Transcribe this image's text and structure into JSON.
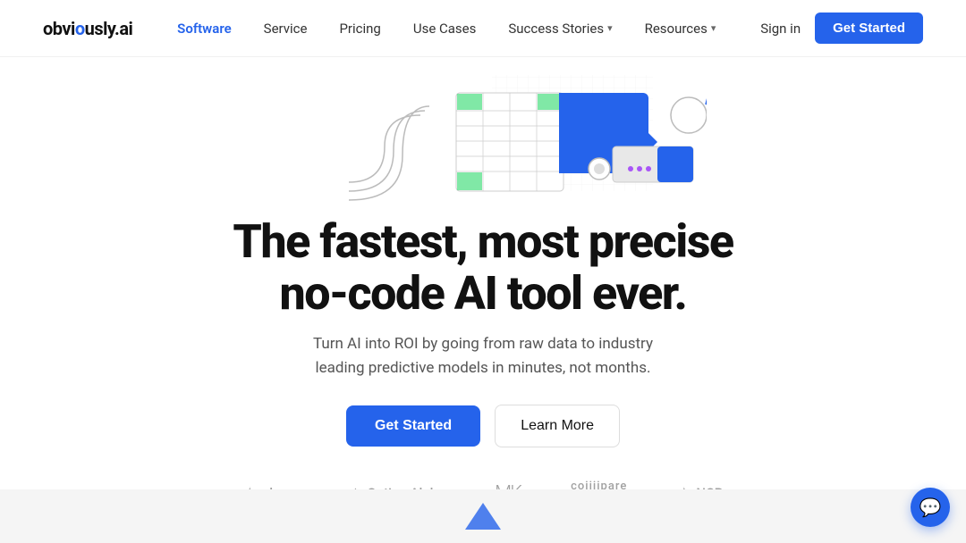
{
  "brand": {
    "name_start": "obvi",
    "name_dot": "o",
    "name_end": "usly.ai"
  },
  "nav": {
    "links": [
      {
        "label": "Software",
        "active": true,
        "has_dropdown": false
      },
      {
        "label": "Service",
        "active": false,
        "has_dropdown": false
      },
      {
        "label": "Pricing",
        "active": false,
        "has_dropdown": false
      },
      {
        "label": "Use Cases",
        "active": false,
        "has_dropdown": false
      },
      {
        "label": "Success Stories",
        "active": false,
        "has_dropdown": true
      },
      {
        "label": "Resources",
        "active": false,
        "has_dropdown": true
      }
    ],
    "sign_in": "Sign in",
    "get_started": "Get Started"
  },
  "hero": {
    "title_line1": "The fastest, most precise",
    "title_line2": "no-code AI tool ever.",
    "subtitle": "Turn AI into ROI by going from raw data to industry leading predictive models in minutes, not months.",
    "cta_primary": "Get Started",
    "cta_secondary": "Learn More"
  },
  "logos": [
    {
      "name": "plume",
      "symbol": "✦",
      "label": "plume"
    },
    {
      "name": "option-alpha",
      "symbol": "△",
      "label": "Option Alpha"
    },
    {
      "name": "mk",
      "symbol": "✦",
      "label": "MK"
    },
    {
      "name": "compare-credit",
      "symbol": "⬡",
      "label": "coiiiipare credit"
    },
    {
      "name": "ncr",
      "symbol": "✦",
      "label": "NCR"
    }
  ],
  "chat": {
    "icon": "💬"
  }
}
